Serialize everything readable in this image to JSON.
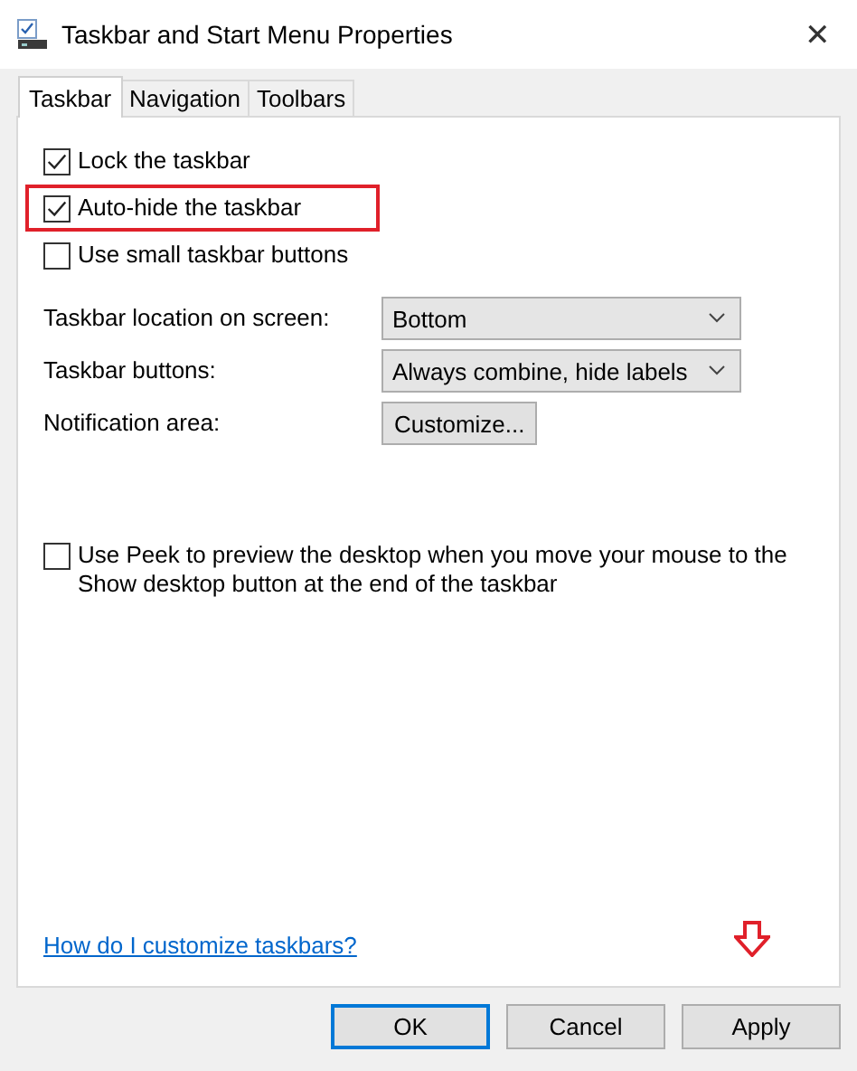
{
  "window": {
    "title": "Taskbar and Start Menu Properties",
    "close": "✕"
  },
  "tabs": [
    {
      "label": "Taskbar",
      "selected": true
    },
    {
      "label": "Navigation",
      "selected": false
    },
    {
      "label": "Toolbars",
      "selected": false
    }
  ],
  "checkboxes": [
    {
      "label": "Lock the taskbar",
      "checked": true,
      "highlighted": false
    },
    {
      "label": "Auto-hide the taskbar",
      "checked": true,
      "highlighted": true
    },
    {
      "label": "Use small taskbar buttons",
      "checked": false,
      "highlighted": false
    }
  ],
  "settings": [
    {
      "kind": "dropdown",
      "label": "Taskbar location on screen:",
      "value": "Bottom"
    },
    {
      "kind": "dropdown",
      "label": "Taskbar buttons:",
      "value": "Always combine, hide labels"
    },
    {
      "kind": "button",
      "label": "Notification area:",
      "value": "Customize..."
    }
  ],
  "peek": {
    "label": "Use Peek to preview the desktop when you move your mouse to the Show desktop button at the end of the taskbar",
    "checked": false
  },
  "help_link": "How do I customize taskbars?",
  "buttons": [
    {
      "label": "OK",
      "default": true
    },
    {
      "label": "Cancel",
      "default": false
    },
    {
      "label": "Apply",
      "default": false
    }
  ]
}
